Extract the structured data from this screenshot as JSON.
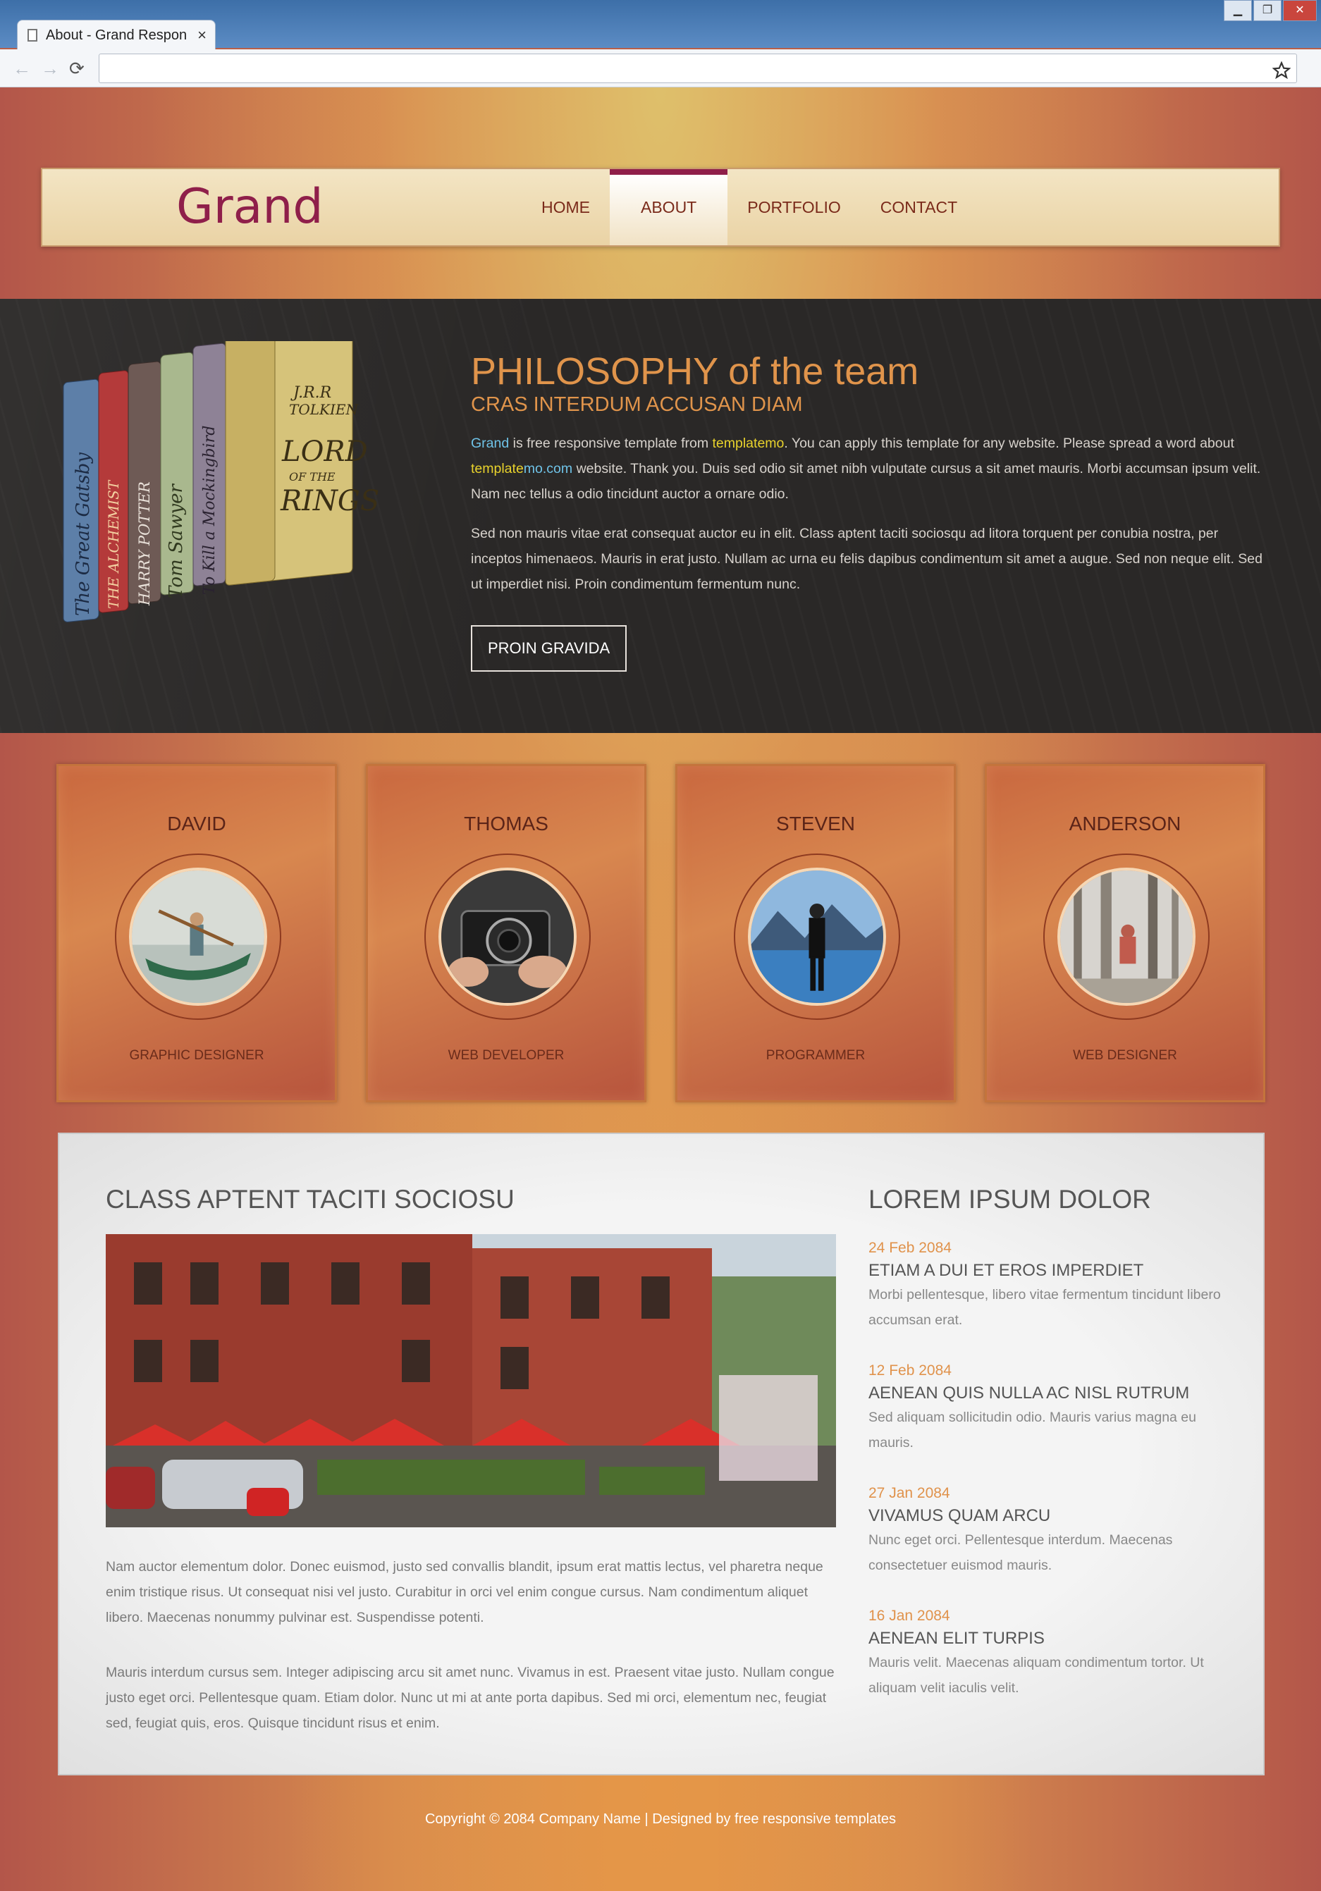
{
  "browser": {
    "tab_title": "About - Grand Respon",
    "tab_close": "×",
    "window_buttons": [
      "▁",
      "❐",
      "✕"
    ],
    "nav_back": "←",
    "nav_forward": "→",
    "reload": "⟳",
    "url": ""
  },
  "site": {
    "logo": "Grand",
    "menu": [
      "HOME",
      "ABOUT",
      "PORTFOLIO",
      "CONTACT"
    ],
    "active_menu": "ABOUT"
  },
  "hero": {
    "title": "PHILOSOPHY of the team",
    "subtitle": "CRAS INTERDUM ACCUSAN DIAM",
    "p1": {
      "grand": "Grand",
      "t1": " is free responsive template from ",
      "templatemo": "templatemo",
      "t2": ". You can apply this template for any website. Please spread a word about ",
      "template": "template",
      "mo_com": "mo.com",
      "t3": " website. Thank you. Duis sed odio sit amet nibh vulputate cursus a sit amet mauris. Morbi accumsan ipsum velit. Nam nec tellus a odio tincidunt auctor a ornare odio."
    },
    "p2": "Sed non mauris vitae erat consequat auctor eu in elit. Class aptent taciti sociosqu ad litora torquent per conubia nostra, per inceptos himenaeos. Mauris in erat justo. Nullam ac urna eu felis dapibus condimentum sit amet a augue. Sed non neque elit. Sed ut imperdiet nisi. Proin condimentum fermentum nunc.",
    "button": "PROIN GRAVIDA",
    "book_spines": [
      "The Great Gatsby",
      "THE ALCHEMIST",
      "HARRY POTTER",
      "Tom Sawyer",
      "To Kill a Mockingbird"
    ],
    "book_cover": [
      "J.R.R",
      "TOLKIEN",
      "LORD",
      "OF THE",
      "RINGS"
    ]
  },
  "team": [
    {
      "name": "DAVID",
      "role": "GRAPHIC DESIGNER"
    },
    {
      "name": "THOMAS",
      "role": "WEB DEVELOPER"
    },
    {
      "name": "STEVEN",
      "role": "PROGRAMMER"
    },
    {
      "name": "ANDERSON",
      "role": "WEB DESIGNER"
    }
  ],
  "main": {
    "left_title": "CLASS APTENT TACITI SOCIOSU",
    "p1": "Nam auctor elementum dolor. Donec euismod, justo sed convallis blandit, ipsum erat mattis lectus, vel pharetra neque enim tristique risus. Ut consequat nisi vel justo. Curabitur in orci vel enim congue cursus. Nam condimentum aliquet libero. Maecenas nonummy pulvinar est. Suspendisse potenti.",
    "p2": "Mauris interdum cursus sem. Integer adipiscing arcu sit amet nunc. Vivamus in est. Praesent vitae justo. Nullam congue justo eget orci. Pellentesque quam. Etiam dolor. Nunc ut mi at ante porta dapibus. Sed mi orci, elementum nec, feugiat sed, feugiat quis, eros. Quisque tincidunt risus et enim.",
    "right_title": "LOREM IPSUM DOLOR",
    "news": [
      {
        "date": "24 Feb 2084",
        "title": "ETIAM A DUI ET EROS IMPERDIET",
        "desc": "Morbi pellentesque, libero vitae fermentum tincidunt libero accumsan erat."
      },
      {
        "date": "12 Feb 2084",
        "title": "AENEAN QUIS NULLA AC NISL RUTRUM",
        "desc": "Sed aliquam sollicitudin odio. Mauris varius magna eu mauris."
      },
      {
        "date": "27 Jan 2084",
        "title": "VIVAMUS QUAM ARCU",
        "desc": "Nunc eget orci. Pellentesque interdum. Maecenas consectetuer euismod mauris."
      },
      {
        "date": "16 Jan 2084",
        "title": "AENEAN ELIT TURPIS",
        "desc": "Mauris velit. Maecenas aliquam condimentum tortor. Ut aliquam velit iaculis velit."
      }
    ]
  },
  "footer": "Copyright © 2084 Company Name | Designed by free responsive templates",
  "colors": {
    "accent": "#e0944b",
    "brand": "#8f1f4a",
    "link_blue": "#6fc3e8",
    "link_yellow": "#e8d22c"
  }
}
